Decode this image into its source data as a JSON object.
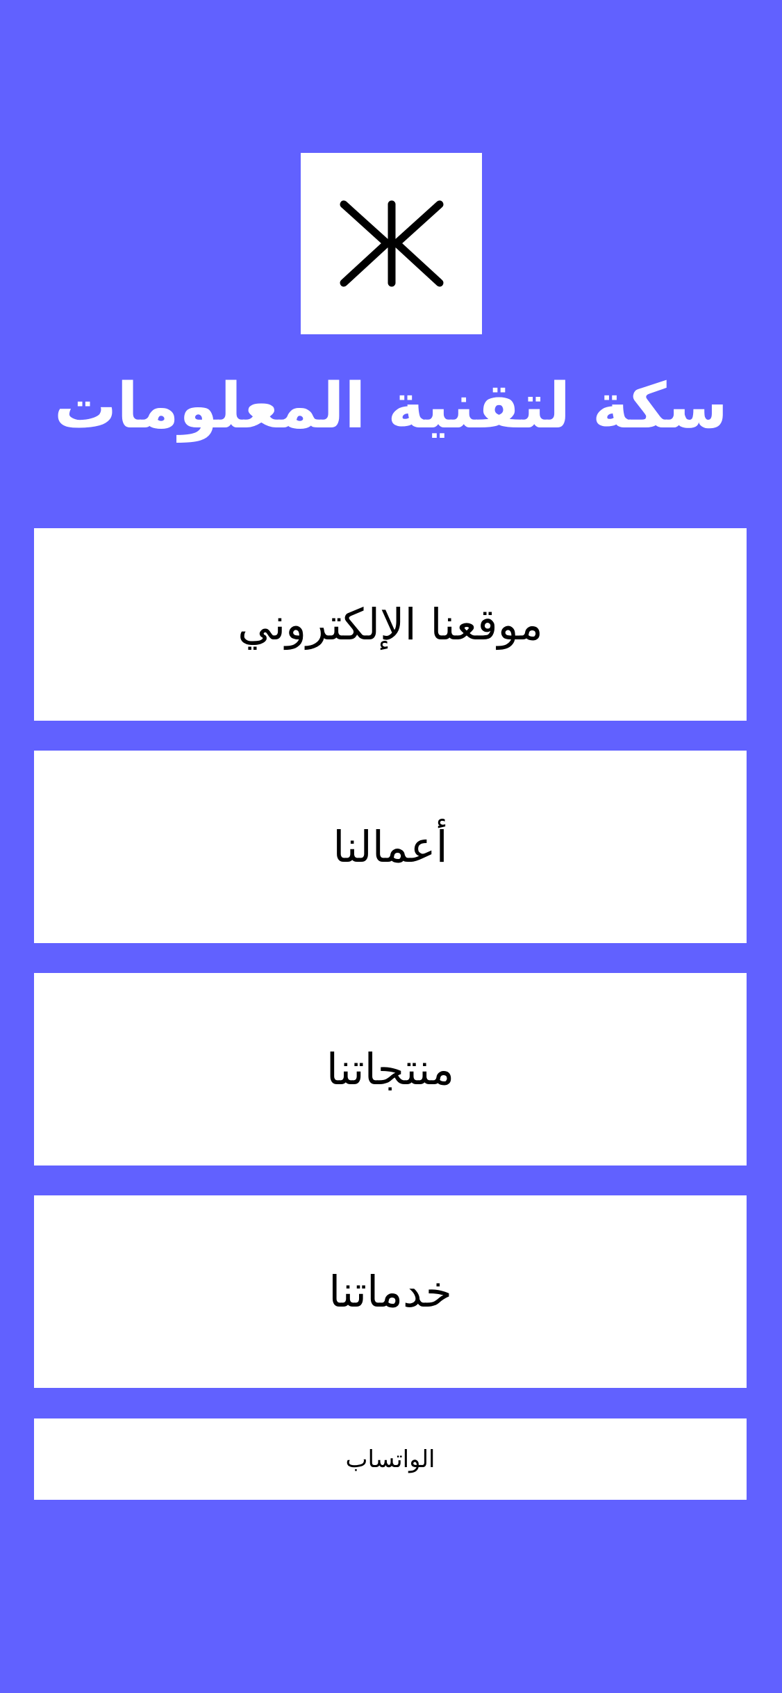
{
  "header": {
    "logo_icon": "k-mirror-logo-icon",
    "title": "سكة لتقنية المعلومات"
  },
  "links": [
    {
      "label": "موقعنا الإلكتروني"
    },
    {
      "label": "أعمالنا"
    },
    {
      "label": "منتجاتنا"
    },
    {
      "label": "خدماتنا"
    },
    {
      "label": "الواتساب"
    }
  ],
  "colors": {
    "background": "#6161ff",
    "button_background": "#ffffff",
    "button_text": "#000000",
    "title_text": "#ffffff"
  }
}
